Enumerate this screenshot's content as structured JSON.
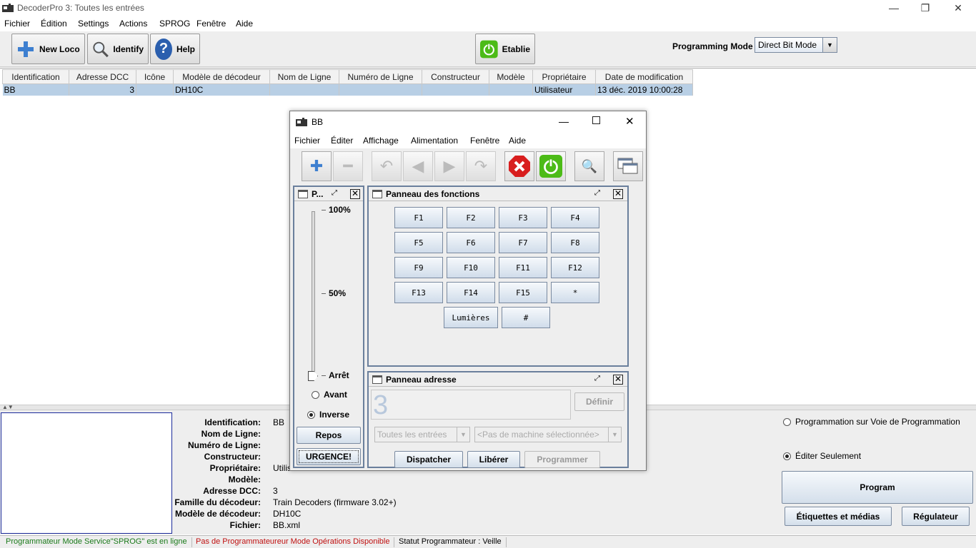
{
  "window": {
    "title": "DecoderPro 3: Toutes les entrées",
    "controls": {
      "minimize": "—",
      "restore": "❐",
      "close": "✕"
    }
  },
  "menu": [
    "Fichier",
    "Édition",
    "Settings",
    "Actions",
    "SPROG",
    "Fenêtre",
    "Aide"
  ],
  "toolbar": {
    "new_loco": "New Loco",
    "identify": "Identify",
    "help": "Help",
    "power": "Etablie",
    "programming_mode_label": "Programming Mode",
    "programming_mode_value": "Direct Bit Mode"
  },
  "table": {
    "headers": [
      "Identification",
      "Adresse DCC",
      "Icône",
      "Modèle de décodeur",
      "Nom de Ligne",
      "Numéro de Ligne",
      "Constructeur",
      "Modèle",
      "Propriétaire",
      "Date de modification"
    ],
    "rows": [
      [
        "BB",
        "3",
        "",
        "DH10C",
        "",
        "",
        "",
        "",
        "Utilisateur",
        "13 déc. 2019 10:00:28"
      ]
    ]
  },
  "details": {
    "labels": [
      "Identification:",
      "Nom de Ligne:",
      "Numéro de Ligne:",
      "Constructeur:",
      "Propriétaire:",
      "Modèle:",
      "Adresse DCC:",
      "Famille du décodeur:",
      "Modèle de décodeur:",
      "Fichier:"
    ],
    "values": [
      "BB",
      "",
      "",
      "",
      "Utilisateur",
      "",
      "3",
      "Train Decoders (firmware 3.02+)",
      "DH10C",
      "BB.xml"
    ]
  },
  "right_panel": {
    "radio_track": "Programmation sur Voie de Programmation",
    "radio_edit": "Éditer Seulement",
    "program": "Program",
    "labels_media": "Étiquettes et médias",
    "regulator": "Régulateur"
  },
  "statusbar": {
    "s1": "Programmateur Mode Service\"SPROG\" est en ligne",
    "s2": "Pas de Programmateureur Mode Opérations Disponible",
    "s3": "Statut Programmateur :  Veille",
    "s1_color": "#1a7a1a",
    "s2_color": "#c01010"
  },
  "throttle": {
    "title": "BB",
    "menu": [
      "Fichier",
      "Éditer",
      "Affichage",
      "Alimentation",
      "Fenêtre",
      "Aide"
    ],
    "control_panel": {
      "title": "P...",
      "tick_100": "100%",
      "tick_50": "50%",
      "tick_stop": "Arrêt",
      "forward": "Avant",
      "reverse": "Inverse",
      "idle": "Repos",
      "emergency": "URGENCE!"
    },
    "functions": {
      "title": "Panneau des fonctions",
      "buttons": [
        "F1",
        "F2",
        "F3",
        "F4",
        "F5",
        "F6",
        "F7",
        "F8",
        "F9",
        "F10",
        "F11",
        "F12",
        "F13",
        "F14",
        "F15",
        "*"
      ],
      "lights": "Lumières",
      "hash": "#"
    },
    "address": {
      "title": "Panneau adresse",
      "value": "3",
      "set": "Définir",
      "roster_select": "Toutes les entrées",
      "machine_select": "<Pas de machine sélectionnée>",
      "dispatch": "Dispatcher",
      "release": "Libérer",
      "program": "Programmer"
    }
  },
  "colors": {
    "accent_blue": "#1b2a9a",
    "selection": "#b8cfe5",
    "power_green": "#4cbb17",
    "stop_red": "#d81e1e"
  }
}
